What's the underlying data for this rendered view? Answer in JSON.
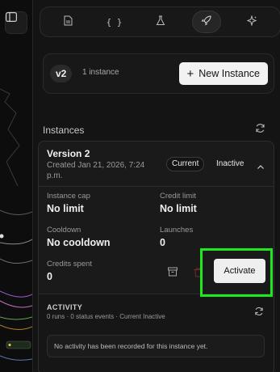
{
  "sidebar_toggle": {
    "icon": "sidebar-toggle-icon"
  },
  "toolbar": {
    "tools": [
      {
        "name": "document",
        "icon": "document-icon",
        "active": false
      },
      {
        "name": "json",
        "label": "{ }",
        "icon": "braces-icon",
        "active": false
      },
      {
        "name": "flask",
        "icon": "flask-icon",
        "active": false
      },
      {
        "name": "rocket",
        "icon": "rocket-icon",
        "active": true
      },
      {
        "name": "sparkle",
        "icon": "sparkle-icon",
        "active": false
      }
    ]
  },
  "version": {
    "pill": "v2",
    "instance_count": "1 instance",
    "new_instance_label": "New Instance"
  },
  "instances_title": "Instances",
  "instance": {
    "name": "Version 2",
    "created": "Created Jan 21, 2026, 7:24 p.m.",
    "current_badge": "Current",
    "status_badge": "Inactive",
    "stats": {
      "instance_cap_label": "Instance cap",
      "instance_cap_value": "No limit",
      "credit_limit_label": "Credit limit",
      "credit_limit_value": "No limit",
      "cooldown_label": "Cooldown",
      "cooldown_value": "No cooldown",
      "launches_label": "Launches",
      "launches_value": "0",
      "credits_spent_label": "Credits spent",
      "credits_spent_value": "0"
    },
    "activate_label": "Activate"
  },
  "activity": {
    "title": "ACTIVITY",
    "summary": "0 runs · 0 status events · Current Inactive",
    "empty_message": "No activity has been recorded for this instance yet."
  },
  "colors": {
    "highlight": "#1ee81e",
    "danger": "#7a2c2c"
  }
}
